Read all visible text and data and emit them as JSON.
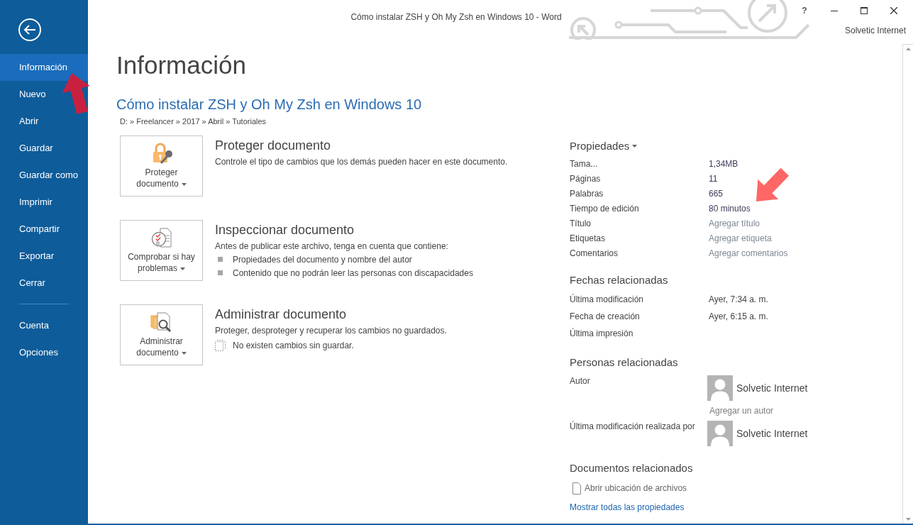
{
  "window": {
    "title": "Cómo instalar ZSH y Oh My Zsh en Windows 10 - Word",
    "help": "?",
    "user": "Solvetic Internet"
  },
  "sidebar": {
    "groups": [
      {
        "items": [
          {
            "label": "Información",
            "selected": true
          },
          {
            "label": "Nuevo",
            "selected": false
          },
          {
            "label": "Abrir",
            "selected": false
          },
          {
            "label": "Guardar",
            "selected": false
          },
          {
            "label": "Guardar como",
            "selected": false
          },
          {
            "label": "Imprimir",
            "selected": false
          },
          {
            "label": "Compartir",
            "selected": false
          },
          {
            "label": "Exportar",
            "selected": false
          },
          {
            "label": "Cerrar",
            "selected": false
          }
        ]
      },
      {
        "items": [
          {
            "label": "Cuenta",
            "selected": false
          },
          {
            "label": "Opciones",
            "selected": false
          }
        ]
      }
    ]
  },
  "page": {
    "heading": "Información",
    "document_title": "Cómo instalar ZSH y Oh My Zsh en Windows 10",
    "path": "D: » Freelancer » 2017 » Abril » Tutoriales"
  },
  "actions": [
    {
      "kind": "protect",
      "button": "Proteger documento",
      "title": "Proteger documento",
      "description": "Controle el tipo de cambios que los demás pueden hacer en este documento."
    },
    {
      "kind": "inspect",
      "button": "Comprobar si hay problemas",
      "title": "Inspeccionar documento",
      "description": "Antes de publicar este archivo, tenga en cuenta que contiene:",
      "bullets": [
        "Propiedades del documento y nombre del autor",
        "Contenido que no podrán leer las personas con discapacidades"
      ]
    },
    {
      "kind": "manage",
      "button": "Administrar documento",
      "title": "Administrar documento",
      "description": "Proteger, desproteger y recuperar los cambios no guardados.",
      "note": "No existen cambios sin guardar."
    }
  ],
  "properties": {
    "heading": "Propiedades",
    "rows": [
      {
        "label": "Tama...",
        "value": "1,34MB"
      },
      {
        "label": "Páginas",
        "value": "11"
      },
      {
        "label": "Palabras",
        "value": "665"
      },
      {
        "label": "Tiempo de edición",
        "value": "80 minutos"
      },
      {
        "label": "Título",
        "placeholder": "Agregar título"
      },
      {
        "label": "Etiquetas",
        "placeholder": "Agregar etiqueta"
      },
      {
        "label": "Comentarios",
        "placeholder": "Agregar comentarios"
      }
    ]
  },
  "related_dates": {
    "heading": "Fechas relacionadas",
    "rows": [
      {
        "label": "Última modificación",
        "value": "Ayer, 7:34 a. m."
      },
      {
        "label": "Fecha de creación",
        "value": "Ayer, 6:15 a. m."
      },
      {
        "label": "Última impresión"
      }
    ]
  },
  "related_people": {
    "heading": "Personas relacionadas",
    "rows": [
      {
        "label": "Autor",
        "people": [
          {
            "name": "Solvetic Internet"
          }
        ],
        "placeholder": "Agregar un autor"
      },
      {
        "label": "Última modificación realizada por",
        "people": [
          {
            "name": "Solvetic Internet"
          }
        ]
      }
    ]
  },
  "related_documents": {
    "heading": "Documentos relacionados",
    "items": [
      "Abrir ubicación de archivos"
    ],
    "link": "Mostrar todas las propiedades"
  }
}
